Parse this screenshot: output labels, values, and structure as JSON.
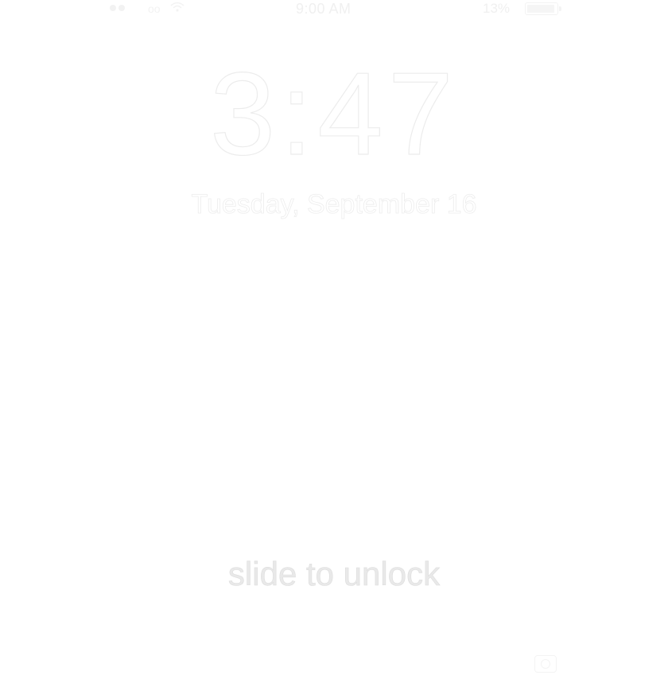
{
  "status_bar": {
    "signal_bars": 2,
    "carrier": "oo",
    "time": "9:00 AM",
    "battery_percent_text": "13%",
    "battery_level": 0.95,
    "icons": [
      "signal-icon",
      "wifi-icon",
      "battery-icon"
    ]
  },
  "lock_screen": {
    "clock": "3:47",
    "date": "Tuesday, September 16"
  },
  "slider": {
    "label": "slide to unlock"
  },
  "bottom_bar": {
    "icons": [
      "camera-icon"
    ]
  },
  "colors": {
    "background": "#ffffff",
    "text": "#ececec"
  }
}
